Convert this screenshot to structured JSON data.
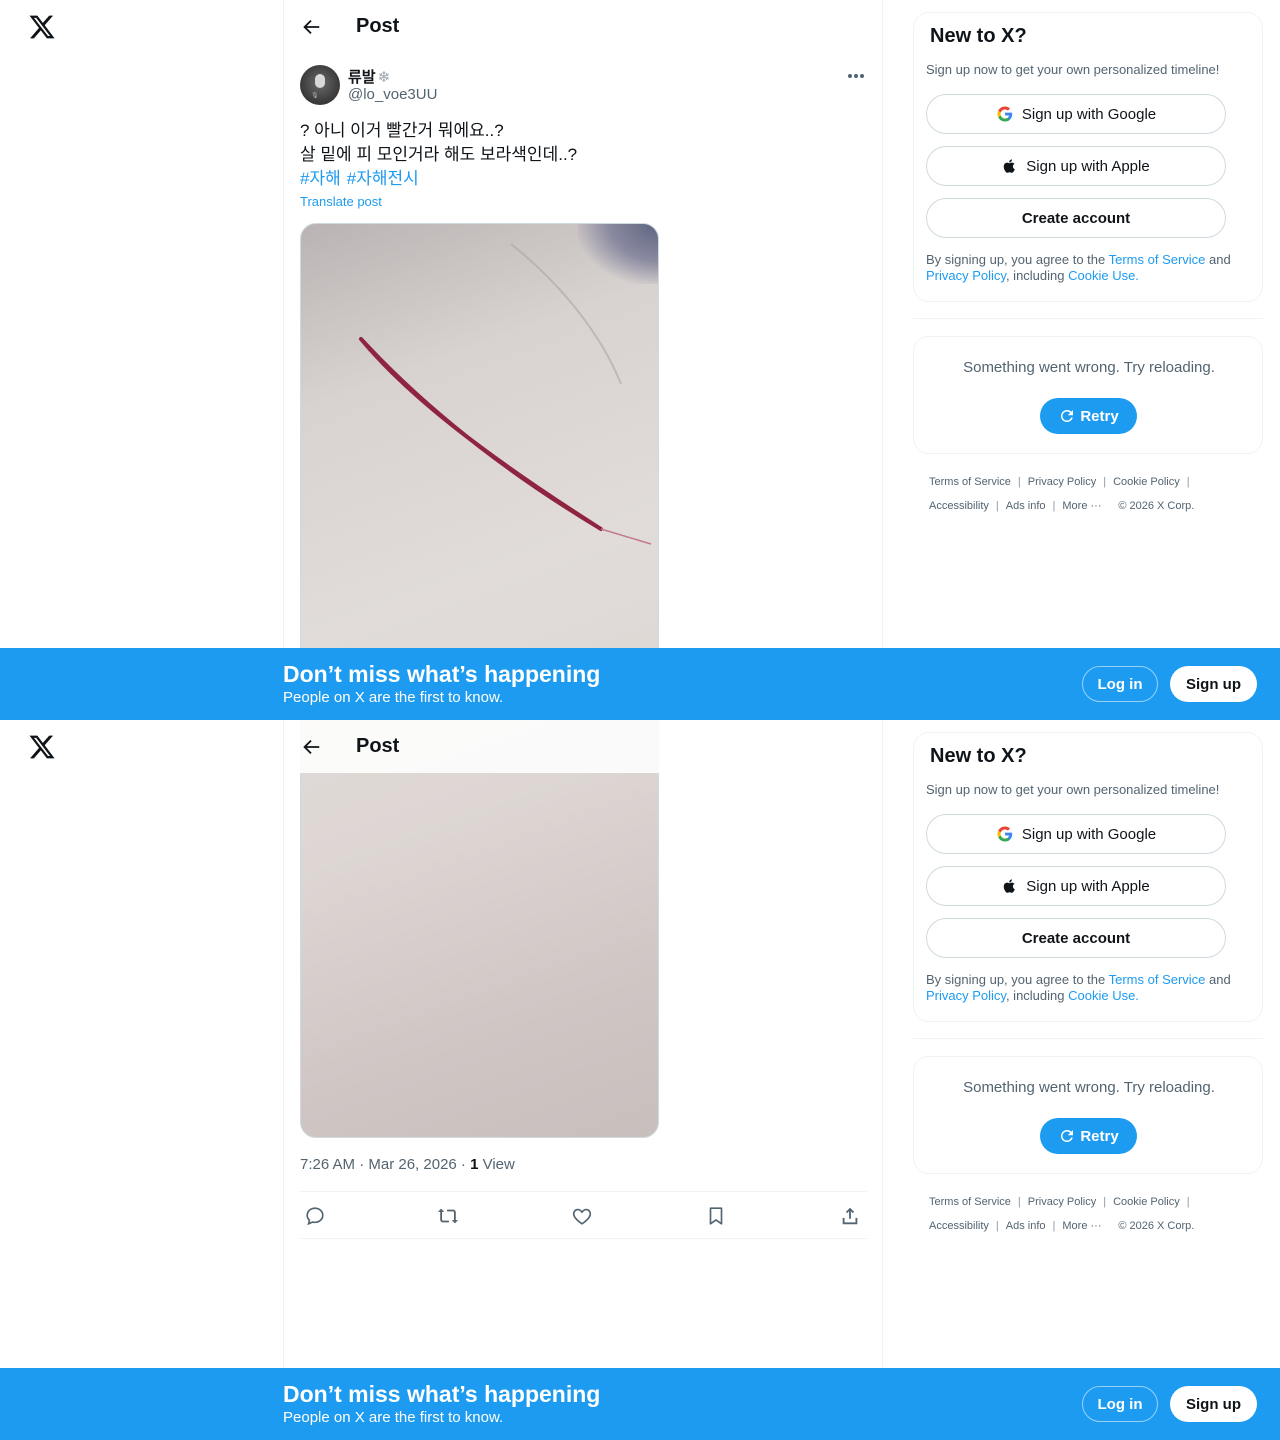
{
  "header": {
    "title": "Post"
  },
  "post": {
    "display_name": "류발",
    "name_emoji": "❄",
    "handle": "@lo_voe3UU",
    "text_lines": [
      "? 아니 이거 빨간거 뭐에요..?",
      "살 밑에 피 모인거라 해도 보라색인데..?"
    ],
    "hashtags": [
      "#자해",
      "#자해전시"
    ],
    "translate_label": "Translate post",
    "time": "7:26 AM · Mar 26, 2026 · ",
    "views_count": "1",
    "views_label": " View"
  },
  "signup_card": {
    "title": "New to X?",
    "subtitle": "Sign up now to get your own personalized timeline!",
    "google_label": "Sign up with Google",
    "apple_label": "Sign up with Apple",
    "create_label": "Create account",
    "terms_prefix": "By signing up, you agree to the ",
    "terms_link": "Terms of Service",
    "terms_mid": " and ",
    "privacy_link": "Privacy Policy",
    "terms_mid2": ", including ",
    "cookie_link": "Cookie Use."
  },
  "error_card": {
    "message": "Something went wrong. Try reloading.",
    "retry_label": "Retry"
  },
  "footer": {
    "terms": "Terms of Service",
    "privacy": "Privacy Policy",
    "cookie": "Cookie Policy",
    "accessibility": "Accessibility",
    "ads": "Ads info",
    "more": "More ···",
    "copyright": "© 2026 X Corp."
  },
  "banner": {
    "title": "Don’t miss what’s happening",
    "subtitle": "People on X are the first to know.",
    "login_label": "Log in",
    "signup_label": "Sign up"
  },
  "colors": {
    "accent": "#1d9bf0",
    "text": "#0f1419",
    "muted": "#536471"
  }
}
